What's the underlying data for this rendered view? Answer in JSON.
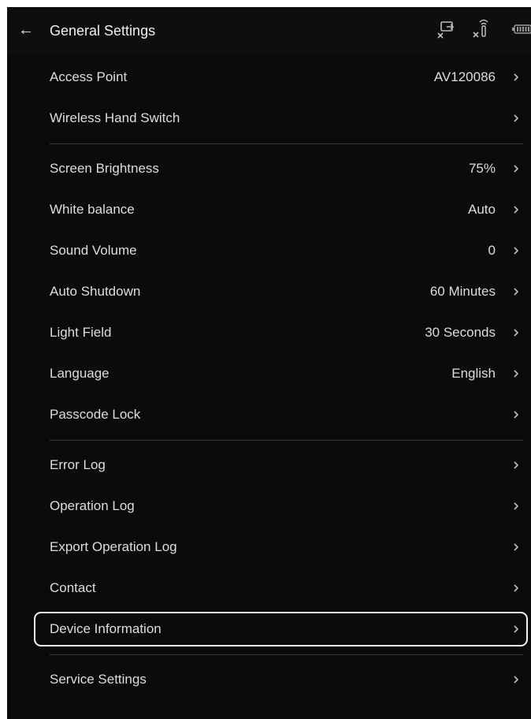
{
  "header": {
    "title": "General Settings",
    "back_icon": "arrow-left-icon",
    "status_icons": [
      "screen-cast-disconnected-icon",
      "wireless-disconnected-icon",
      "battery-icon"
    ]
  },
  "colors": {
    "background": "#0b0b0b",
    "text": "#dddddd",
    "divider": "#3a3a3a",
    "highlight_border": "#f2f2f2"
  },
  "groups": [
    {
      "items": [
        {
          "label": "Access Point",
          "value": "AV120086"
        },
        {
          "label": "Wireless Hand Switch",
          "value": ""
        }
      ]
    },
    {
      "items": [
        {
          "label": "Screen Brightness",
          "value": "75%"
        },
        {
          "label": "White balance",
          "value": "Auto"
        },
        {
          "label": "Sound Volume",
          "value": "0"
        },
        {
          "label": "Auto Shutdown",
          "value": "60 Minutes"
        },
        {
          "label": "Light Field",
          "value": "30 Seconds"
        },
        {
          "label": "Language",
          "value": "English"
        },
        {
          "label": "Passcode Lock",
          "value": ""
        }
      ]
    },
    {
      "items": [
        {
          "label": "Error Log",
          "value": ""
        },
        {
          "label": "Operation Log",
          "value": ""
        },
        {
          "label": "Export Operation Log",
          "value": ""
        },
        {
          "label": "Contact",
          "value": ""
        },
        {
          "label": "Device Information",
          "value": "",
          "highlighted": true
        }
      ]
    },
    {
      "items": [
        {
          "label": "Service Settings",
          "value": ""
        }
      ]
    }
  ]
}
